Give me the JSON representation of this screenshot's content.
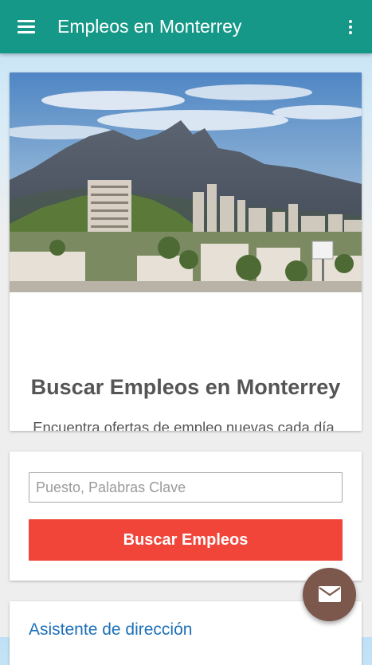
{
  "appbar": {
    "title": "Empleos en Monterrey",
    "menu_icon": "hamburger-menu-icon",
    "more_icon": "more-vertical-icon",
    "color": "#159887"
  },
  "hero": {
    "image_icon": "city-mountain-photo",
    "heading": "Buscar Empleos en Monterrey",
    "description": "Encuentra ofertas de empleo nuevas cada día, usa nuestro buscador para encontrar ofertas de trabajo locales."
  },
  "search": {
    "input_value": "",
    "input_placeholder": "Puesto, Palabras Clave",
    "button_label": "Buscar Empleos",
    "button_color": "#f2453a"
  },
  "assistant": {
    "link_label": "Asistente de dirección",
    "link_color": "#1e70b8"
  },
  "fab": {
    "icon": "mail-icon",
    "color": "#7b574c"
  }
}
